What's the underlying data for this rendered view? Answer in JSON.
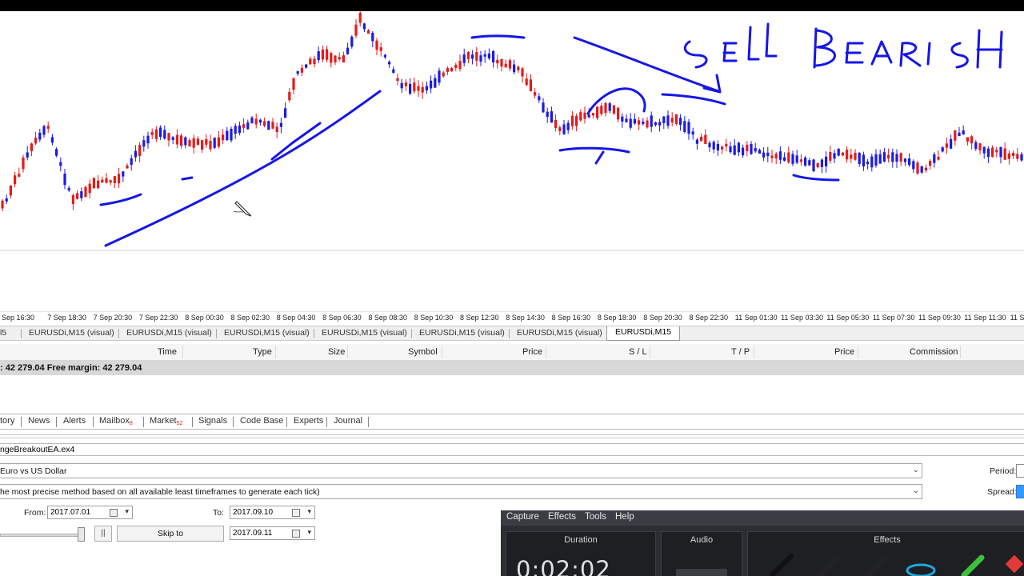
{
  "annotations": {
    "handwriting_text": "SELL BEARISH"
  },
  "time_axis": {
    "labels": [
      "Sep 16:30",
      "7 Sep 18:30",
      "7 Sep 20:30",
      "7 Sep 22:30",
      "8 Sep 00:30",
      "8 Sep 02:30",
      "8 Sep 04:30",
      "8 Sep 06:30",
      "8 Sep 08:30",
      "8 Sep 10:30",
      "8 Sep 12:30",
      "8 Sep 14:30",
      "8 Sep 16:30",
      "8 Sep 18:30",
      "8 Sep 20:30",
      "8 Sep 22:30",
      "11 Sep 01:30",
      "11 Sep 03:30",
      "11 Sep 05:30",
      "11 Sep 07:30",
      "11 Sep 09:30",
      "11 Sep 11:30",
      "11 Se"
    ]
  },
  "chart_tabs": {
    "items": [
      "l5",
      "EURUSDi,M15 (visual)",
      "EURUSDi,M15 (visual)",
      "EURUSDi,M15 (visual)",
      "EURUSDi,M15 (visual)",
      "EURUSDi,M15 (visual)",
      "EURUSDi,M15 (visual)"
    ],
    "active": "EURUSDi,M15"
  },
  "trade_grid": {
    "columns": [
      "Time",
      "Type",
      "Size",
      "Symbol",
      "Price",
      "S / L",
      "T / P",
      "Price",
      "Commission"
    ],
    "balance_line": ": 42 279.04  Free margin: 42 279.04"
  },
  "terminal_tabs": {
    "items": [
      {
        "label": "tory"
      },
      {
        "label": "News"
      },
      {
        "label": "Alerts"
      },
      {
        "label": "Mailbox",
        "badge": "8"
      },
      {
        "label": "Market",
        "badge": "52"
      },
      {
        "label": "Signals"
      },
      {
        "label": "Code Base"
      },
      {
        "label": "Experts"
      },
      {
        "label": "Journal"
      }
    ]
  },
  "tester": {
    "expert": "ngeBreakoutEA.ex4",
    "symbol": "Euro vs US Dollar",
    "model": "he most precise method based on all available least timeframes to generate each tick)",
    "period_label": "Period:",
    "spread_label": "Spread:",
    "from_label": "From:",
    "from_value": "2017.07.01",
    "to_label": "To:",
    "to_value": "2017.09.10",
    "second_date": "2017.09.11",
    "pause_label": "||",
    "skip_label": "Skip to"
  },
  "recorder": {
    "menu": [
      "Capture",
      "Effects",
      "Tools",
      "Help"
    ],
    "panels": {
      "duration_title": "Duration",
      "audio_title": "Audio",
      "effects_title": "Effects"
    },
    "timer": "0:02:02"
  }
}
